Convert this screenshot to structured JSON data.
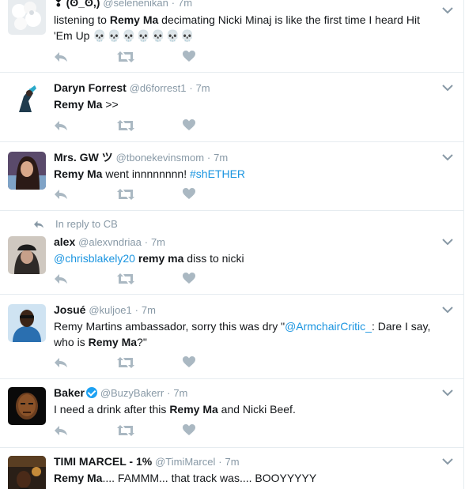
{
  "tweets": [
    {
      "fullname": "❢ (ʘ_ʘ,)",
      "handle": "@selenenikan",
      "time": "7m",
      "text_parts": [
        "listening to ",
        "Remy Ma",
        " decimating Nicki Minaj is like the first time I heard Hit 'Em Up "
      ],
      "skulls": "💀💀💀💀💀💀💀"
    },
    {
      "fullname": "Daryn Forrest",
      "handle": "@d6forrest1",
      "time": "7m",
      "text_parts": [
        "Remy Ma",
        " >>"
      ]
    },
    {
      "fullname": "Mrs. GW ツ",
      "handle": "@tbonekevinsmom",
      "time": "7m",
      "text_parts": [
        "Remy Ma",
        " went innnnnnnn! "
      ],
      "hashtag": "#shETHER"
    },
    {
      "reply_context": "In reply to CB",
      "fullname": "alex",
      "handle": "@alexvndriaa",
      "time": "7m",
      "mention": "@chrisblakely20",
      "text_parts": [
        " ",
        "remy ma",
        " diss to nicki"
      ]
    },
    {
      "fullname": "Josué",
      "handle": "@kuljoe1",
      "time": "7m",
      "text_parts": [
        "Remy Martins ambassador, sorry this was dry \"",
        "@ArmchairCritic_",
        ": Dare I say, who is ",
        "Remy Ma",
        "?\""
      ]
    },
    {
      "fullname": "Baker",
      "handle": "@BuzyBakerr",
      "time": "7m",
      "verified": true,
      "text_parts": [
        "I need a drink after this ",
        "Remy Ma",
        " and Nicki Beef."
      ]
    },
    {
      "fullname": "TIMI MARCEL - 1%",
      "handle": "@TimiMarcel",
      "time": "7m",
      "text_parts": [
        "Remy Ma",
        ".... FAMMM... that track was.... BOOYYYYY"
      ]
    }
  ],
  "separator": "·",
  "colors": {
    "accent": "#1b95e0",
    "muted": "#8899a6",
    "icon": "#aab8c2",
    "verified": "#1da1f2"
  },
  "icons": [
    "reply-icon",
    "retweet-icon",
    "like-icon",
    "caret-down-icon",
    "verified-icon"
  ]
}
